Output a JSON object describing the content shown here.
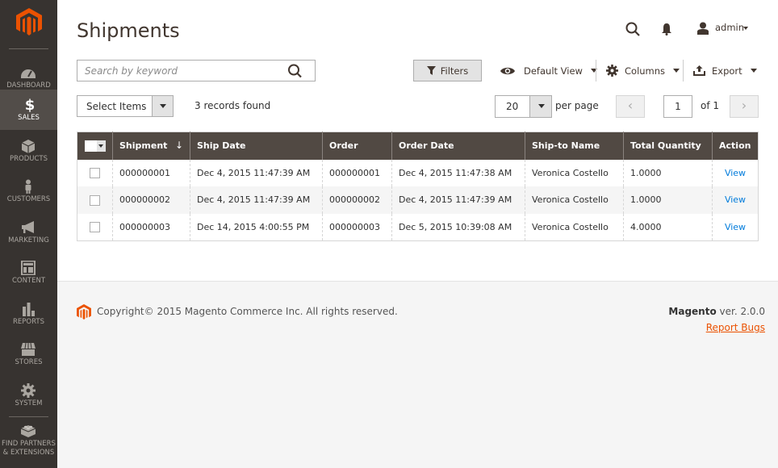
{
  "sidebar": {
    "logo": "magento-logo",
    "items": [
      {
        "label": "DASHBOARD",
        "icon": "dashboard-icon",
        "active": false
      },
      {
        "label": "SALES",
        "icon": "dollar-icon",
        "active": true
      },
      {
        "label": "PRODUCTS",
        "icon": "box-icon",
        "active": false
      },
      {
        "label": "CUSTOMERS",
        "icon": "person-icon",
        "active": false
      },
      {
        "label": "MARKETING",
        "icon": "megaphone-icon",
        "active": false
      },
      {
        "label": "CONTENT",
        "icon": "layout-icon",
        "active": false
      },
      {
        "label": "REPORTS",
        "icon": "bar-chart-icon",
        "active": false
      },
      {
        "label": "STORES",
        "icon": "store-icon",
        "active": false
      },
      {
        "label": "SYSTEM",
        "icon": "gear-icon",
        "active": false
      },
      {
        "label": "FIND PARTNERS & EXTENSIONS",
        "label_line1": "FIND PARTNERS",
        "label_line2": "& EXTENSIONS",
        "icon": "lego-brick-icon",
        "active": false
      }
    ]
  },
  "header": {
    "title": "Shipments",
    "user": "admin"
  },
  "search": {
    "placeholder": "Search by keyword",
    "value": ""
  },
  "toolbar": {
    "filters_label": "Filters",
    "view_label": "Default View",
    "columns_label": "Columns",
    "export_label": "Export"
  },
  "mass_action": {
    "select_label": "Select Items"
  },
  "records_found": "3 records found",
  "pagination": {
    "per_page": "20",
    "per_page_label": "per page",
    "current_page": "1",
    "of_label": "of 1",
    "prev": "‹",
    "next": "›"
  },
  "table": {
    "columns": [
      "Shipment",
      "Ship Date",
      "Order",
      "Order Date",
      "Ship-to Name",
      "Total Quantity",
      "Action"
    ],
    "sort_indicator": "↓",
    "rows": [
      {
        "shipment": "000000001",
        "ship_date": "Dec 4, 2015 11:47:39 AM",
        "order": "000000001",
        "order_date": "Dec 4, 2015 11:47:38 AM",
        "ship_to": "Veronica Costello",
        "qty": "1.0000",
        "action": "View"
      },
      {
        "shipment": "000000002",
        "ship_date": "Dec 4, 2015 11:47:39 AM",
        "order": "000000002",
        "order_date": "Dec 4, 2015 11:47:39 AM",
        "ship_to": "Veronica Costello",
        "qty": "1.0000",
        "action": "View"
      },
      {
        "shipment": "000000003",
        "ship_date": "Dec 14, 2015 4:00:55 PM",
        "order": "000000003",
        "order_date": "Dec 5, 2015 10:39:08 AM",
        "ship_to": "Veronica Costello",
        "qty": "4.0000",
        "action": "View"
      }
    ]
  },
  "footer": {
    "copyright": "Copyright© 2015 Magento Commerce Inc. All rights reserved.",
    "brand": "Magento",
    "version": " ver. 2.0.0",
    "report_bugs": "Report Bugs"
  },
  "colors": {
    "accent": "#eb5202",
    "sidebar_bg": "#373330",
    "sidebar_active": "#524d49",
    "table_header": "#514943",
    "link": "#007bdb"
  }
}
